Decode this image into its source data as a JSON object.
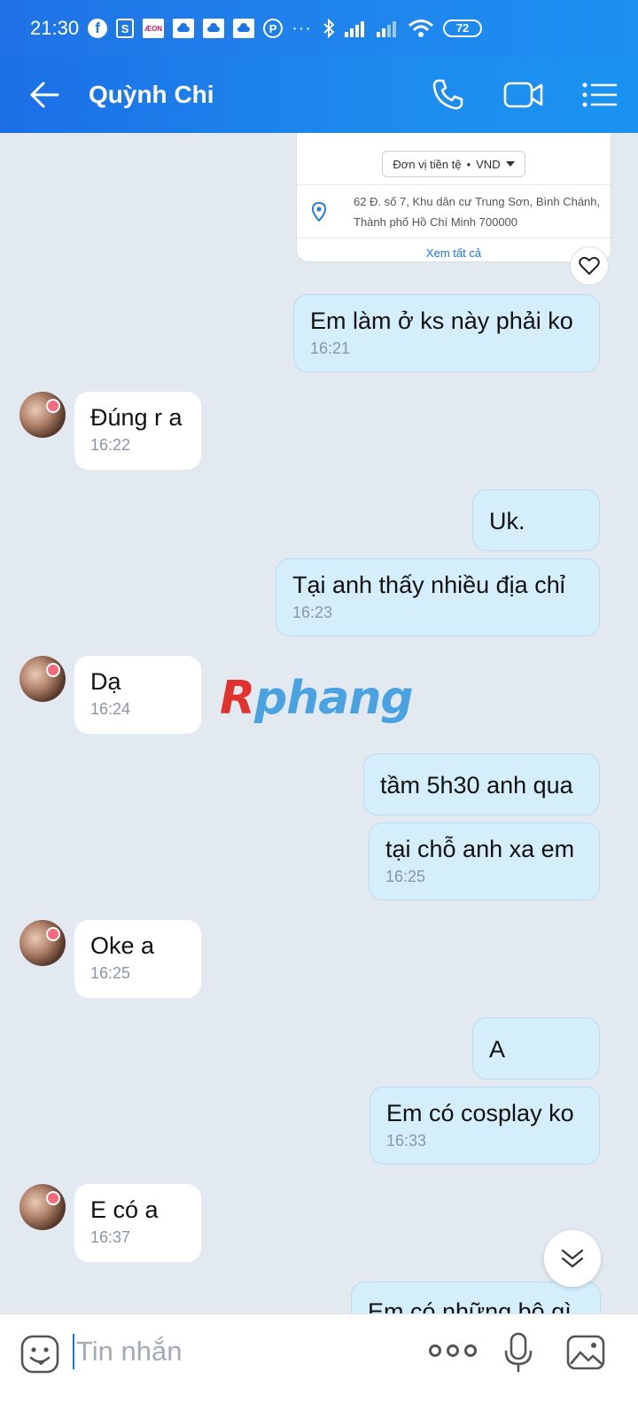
{
  "status_bar": {
    "time": "21:30",
    "fb": "f",
    "bag": "S",
    "aeon": "ÆON",
    "pin": "P",
    "dots": "···",
    "battery": "72"
  },
  "header": {
    "title": "Quỳnh Chi",
    "icons": [
      "back-arrow-icon",
      "phone-icon",
      "video-call-icon",
      "menu-list-icon"
    ]
  },
  "card": {
    "currency_label": "Đơn vị tiền tệ",
    "currency_value": "VND",
    "currency_separator": "•",
    "address_line1": "62 Đ. số 7, Khu dân cư Trung Sơn, Bình Chánh,",
    "address_line2": "Thành phố Hồ Chí Minh 700000",
    "see_all": "Xem tất cả"
  },
  "messages": [
    {
      "side": "out",
      "text": "Em làm ở ks này phải ko",
      "time": "16:21"
    },
    {
      "side": "in",
      "text": "Đúng r a",
      "time": "16:22"
    },
    {
      "side": "out",
      "text": "Uk.",
      "time": ""
    },
    {
      "side": "out",
      "text": "Tại anh thấy nhiều địa chỉ",
      "time": "16:23"
    },
    {
      "side": "in",
      "text": "Dạ",
      "time": "16:24"
    },
    {
      "side": "out",
      "text": "tầm 5h30 anh qua",
      "time": ""
    },
    {
      "side": "out",
      "text": "tại chỗ anh xa em",
      "time": "16:25"
    },
    {
      "side": "in",
      "text": "Oke a",
      "time": "16:25"
    },
    {
      "side": "out",
      "text": "A",
      "time": ""
    },
    {
      "side": "out",
      "text": "Em có cosplay ko",
      "time": "16:33"
    },
    {
      "side": "in",
      "text": "E có a",
      "time": "16:37"
    },
    {
      "side": "out",
      "text": "Em có những bộ gì",
      "time": ""
    }
  ],
  "watermark": {
    "first": "R",
    "rest": "phang"
  },
  "composer": {
    "placeholder": "Tin nhắn",
    "icons": [
      "emoji-icon",
      "more-icon",
      "microphone-icon",
      "image-icon"
    ]
  },
  "colors": {
    "header_blue": "#1d8bee",
    "outgoing_bubble": "#d5eefc",
    "incoming_bubble": "#ffffff",
    "background": "#e2e9f1"
  }
}
